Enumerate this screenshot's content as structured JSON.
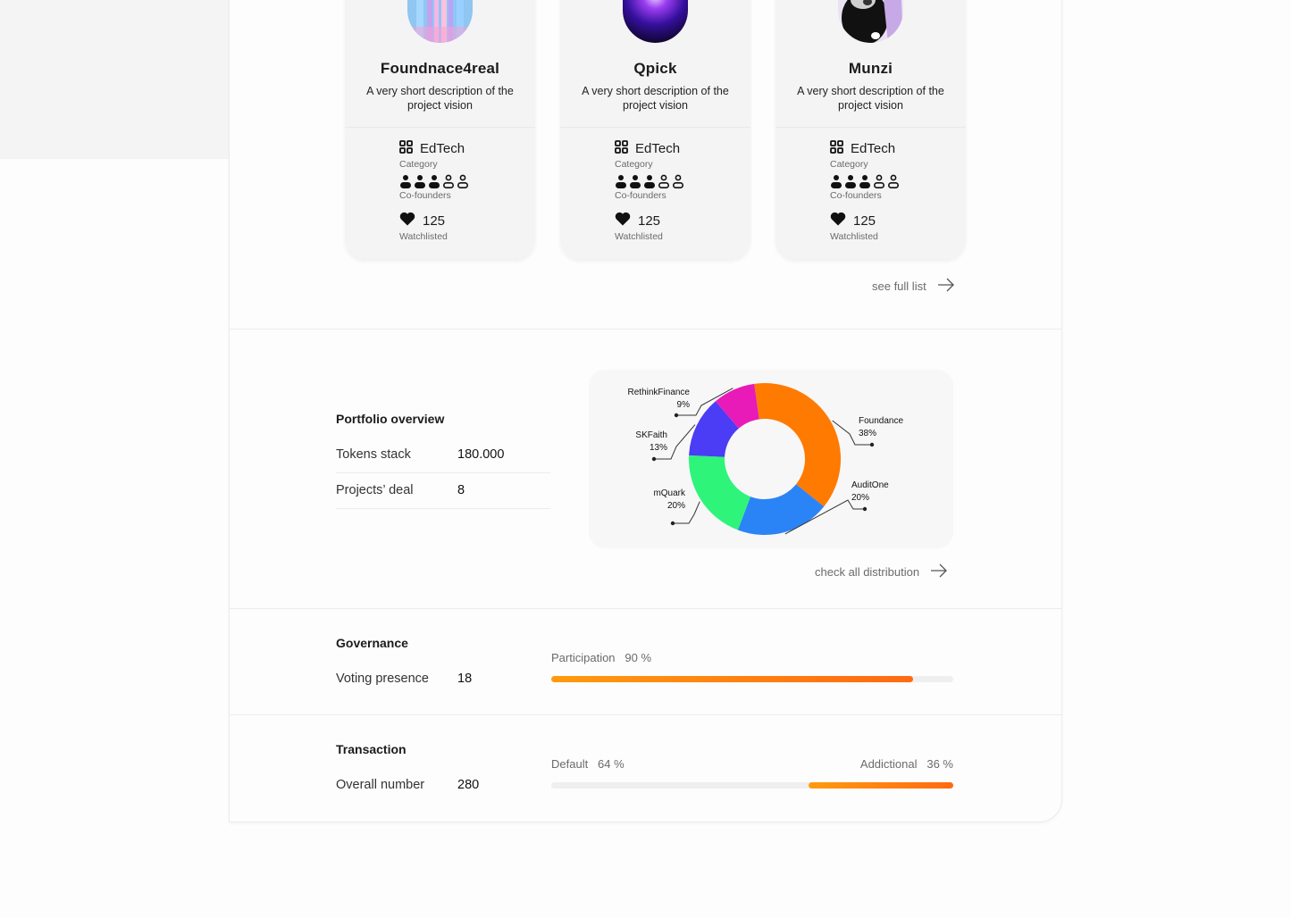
{
  "projects": [
    {
      "name": "Foundnace4real",
      "description": "A very short description of the project vision",
      "category": "EdTech",
      "category_label": "Category",
      "cofounders_label": "Co-founders",
      "cofounders_filled": 3,
      "cofounders_total": 5,
      "watchlisted": "125",
      "watchlisted_label": "Watchlisted"
    },
    {
      "name": "Qpick",
      "description": "A very short description of the project vision",
      "category": "EdTech",
      "category_label": "Category",
      "cofounders_label": "Co-founders",
      "cofounders_filled": 3,
      "cofounders_total": 5,
      "watchlisted": "125",
      "watchlisted_label": "Watchlisted"
    },
    {
      "name": "Munzi",
      "description": "A very short description of the project vision",
      "category": "EdTech",
      "category_label": "Category",
      "cofounders_label": "Co-founders",
      "cofounders_filled": 3,
      "cofounders_total": 5,
      "watchlisted": "125",
      "watchlisted_label": "Watchlisted"
    }
  ],
  "see_full_list": "see full list",
  "portfolio": {
    "title": "Portfolio overview",
    "rows": [
      {
        "label": "Tokens stack",
        "value": "180.000"
      },
      {
        "label": "Projects’ deal",
        "value": "8"
      }
    ],
    "check_all": "check all distribution"
  },
  "chart_data": {
    "type": "pie",
    "donut": true,
    "slices": [
      {
        "name": "Foundance",
        "value": 38,
        "label": "38%",
        "color": "#ff7a00"
      },
      {
        "name": "AuditOne",
        "value": 20,
        "label": "20%",
        "color": "#2b84f5"
      },
      {
        "name": "mQuark",
        "value": 20,
        "label": "20%",
        "color": "#2ef57a"
      },
      {
        "name": "SKFaith",
        "value": 13,
        "label": "13%",
        "color": "#4b3cf5"
      },
      {
        "name": "RethinkFinance",
        "value": 9,
        "label": "9%",
        "color": "#e81ab8"
      }
    ]
  },
  "governance": {
    "title": "Governance",
    "label": "Voting presence",
    "value": "18",
    "participation_label": "Participation",
    "participation_value": "90 %",
    "participation_fraction": 0.9
  },
  "transaction": {
    "title": "Transaction",
    "label": "Overall number",
    "value": "280",
    "default_label": "Default",
    "default_value": "64 %",
    "additional_label": "Addictional",
    "additional_value": "36 %",
    "default_fraction": 0.64,
    "additional_fraction": 0.36
  },
  "colors": {
    "accent": "#ff7a12",
    "card_bg": "#f4f4f4"
  }
}
